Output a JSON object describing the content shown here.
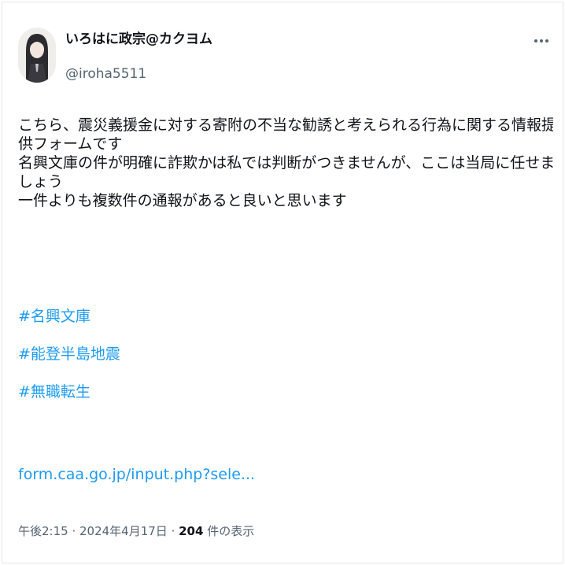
{
  "author": {
    "display_name": "いろはに政宗@カクヨム",
    "handle": "@iroha5511"
  },
  "tweet": {
    "lines": [
      "こちら、震災義援金に対する寄附の不当な勧誘と考えられる行為に関する情報提",
      "供フォームです",
      "名興文庫の件が明確に詐欺かは私では判断がつきませんが、ここは当局に任せま",
      "しょう",
      "一件よりも複数件の通報があると良いと思います"
    ],
    "hashtags": [
      "#名興文庫",
      "#能登半島地震",
      "#無職転生"
    ],
    "link": "form.caa.go.jp/input.php?sele..."
  },
  "meta": {
    "time": "午後2:15",
    "separator1": " · ",
    "date": "2024年4月17日",
    "separator2": " · ",
    "views_count": "204",
    "views_label": " 件の表示"
  },
  "icons": {
    "more": "more-horizontal-icon"
  },
  "colors": {
    "link": "#1d9bf0",
    "text": "#0f1419",
    "secondary": "#536471"
  }
}
